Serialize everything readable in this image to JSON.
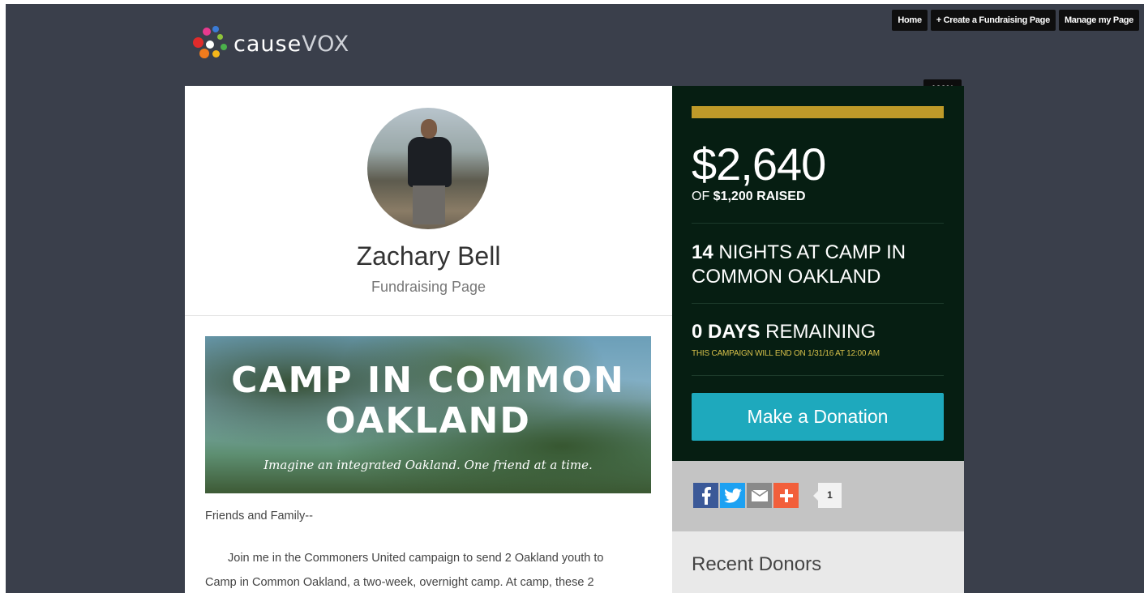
{
  "nav": {
    "home": "Home",
    "create": "+ Create a Fundraising Page",
    "manage": "Manage my Page"
  },
  "logo": {
    "cause": "cause",
    "vox": "VOX"
  },
  "profile": {
    "name": "Zachary Bell",
    "subtitle": "Fundraising Page"
  },
  "banner": {
    "title_line1": "CAMP IN COMMON",
    "title_line2": "OAKLAND",
    "tagline": "Imagine an integrated Oakland. One friend at a time."
  },
  "story": {
    "greeting": "Friends and Family--",
    "paragraph_line1": "Join me in the Commoners United campaign to send 2 Oakland youth to",
    "paragraph_line2": "Camp in Common Oakland, a two-week, overnight camp. At camp, these 2"
  },
  "campaign": {
    "percent_label": "100%",
    "progress_fraction": 1.0,
    "raised_amount": "$2,640",
    "of_label": "OF",
    "goal_amount": "$1,200",
    "raised_label": "RAISED",
    "nights_number": "14",
    "nights_text": "NIGHTS AT CAMP IN COMMON OAKLAND",
    "days_number": "0 DAYS",
    "days_text": "REMAINING",
    "end_note": "THIS CAMPAIGN WILL END ON 1/31/16 AT 12:00 AM",
    "donate_label": "Make a Donation"
  },
  "share": {
    "count": "1",
    "icons": [
      "facebook-icon",
      "twitter-icon",
      "email-icon",
      "plus-icon"
    ]
  },
  "donors": {
    "title": "Recent Donors"
  },
  "colors": {
    "background": "#3a3f4b",
    "panel": "#061e12",
    "progress": "#bf9a29",
    "donate": "#1ea9bd",
    "end_note": "#d6c04a"
  }
}
